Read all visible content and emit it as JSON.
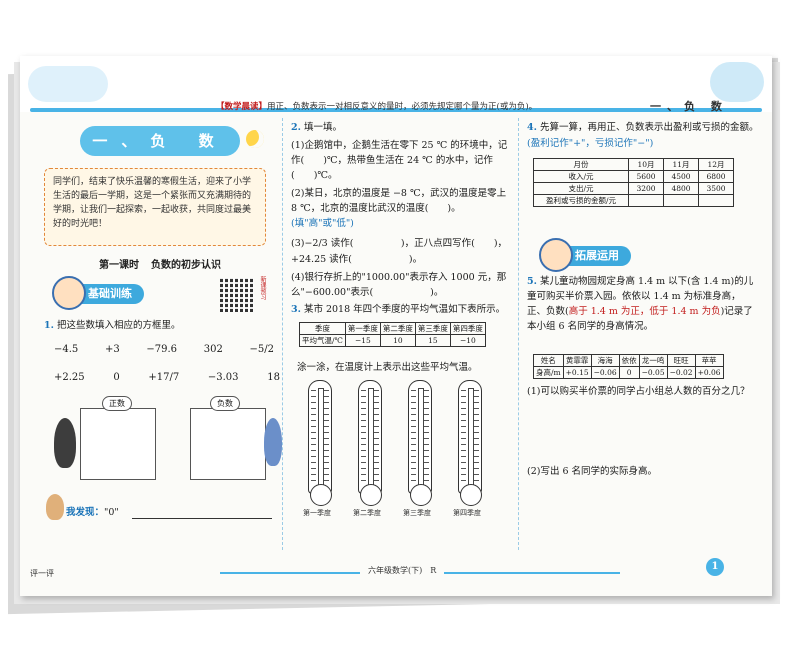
{
  "header": {
    "reading_label": "【数学晨读】",
    "reading_text": "用正、负数表示一对相反意义的量时，必须先规定哪个量为正(或为负)。",
    "unit_title": "一、负 数"
  },
  "col1": {
    "chapter_title": "一、负 数",
    "intro": "同学们，结束了快乐温馨的寒假生活，迎来了小学生活的最后一学期，这是一个紧张而又充满期待的学期，让我们一起探索，一起收获，共同度过最美好的时光吧！",
    "lesson_label": "第一课时",
    "lesson_title": "负数的初步认识",
    "section_tag": "基础训练",
    "qr_label": "新课预习",
    "q1_num": "1.",
    "q1_text": "把这些数填入相应的方框里。",
    "row1": [
      "−4.5",
      "+3",
      "−79.6",
      "302",
      "−5/2"
    ],
    "row2": [
      "+2.25",
      "0",
      "+17/7",
      "−3.03",
      "18"
    ],
    "bubble_positive": "正数",
    "bubble_negative": "负数",
    "find_label": "我发现：",
    "find_text": "\"0\""
  },
  "col2": {
    "q2_num": "2.",
    "q2_title": "填一填。",
    "q2_1": "(1)企鹅馆中，企鹅生活在零下 25 ℃ 的环境中，记作(　　)℃，热带鱼生活在 24 ℃ 的水中，记作(　　)℃。",
    "q2_2": "(2)某日，北京的温度是 −8 ℃，武汉的温度是零上 8 ℃，北京的温度比武汉的温度(　　)。",
    "q2_2_hint": "(填\"高\"或\"低\")",
    "q2_3a": "(3)−2/3 读作(　　　　　)，正八点四写作(　　)，",
    "q2_3b": "+24.25 读作(　　　　　　)。",
    "q2_4": "(4)银行存折上的\"1000.00\"表示存入 1000 元，那么\"−600.00\"表示(　　　　　　)。",
    "q3_num": "3.",
    "q3_text": "某市 2018 年四个季度的平均气温如下表所示。",
    "q3_note": "涂一涂，在温度计上表示出这些平均气温。"
  },
  "table1": {
    "header": [
      "季度",
      "第一季度",
      "第二季度",
      "第三季度",
      "第四季度"
    ],
    "row": [
      "平均气温/℃",
      "−15",
      "10",
      "15",
      "−10"
    ]
  },
  "thermometers": [
    "第一季度",
    "第二季度",
    "第三季度",
    "第四季度"
  ],
  "col3": {
    "q4_num": "4.",
    "q4_text": "先算一算，再用正、负数表示出盈利或亏损的金额。",
    "q4_hint": "(盈利记作\"+\"，亏损记作\"−\")",
    "section_tag": "拓展运用",
    "q5_num": "5.",
    "q5_text": "某儿童动物园规定身高 1.4 m 以下(含 1.4 m)的儿童可购买半价票入园。依依以 1.4 m 为标准身高，正、负数(",
    "q5_hl": "高于 1.4 m 为正，低于 1.4 m 为负",
    "q5_tail": ")记录了本小组 6 名同学的身高情况。",
    "q5_1": "(1)可以购买半价票的同学占小组总人数的百分之几？",
    "q5_2": "(2)写出 6 名同学的实际身高。"
  },
  "table2": {
    "header": [
      "月份",
      "10月",
      "11月",
      "12月"
    ],
    "rows": [
      [
        "收入/元",
        "5600",
        "4500",
        "6800"
      ],
      [
        "支出/元",
        "3200",
        "4800",
        "3500"
      ],
      [
        "盈利或亏损的金额/元",
        "",
        "",
        ""
      ]
    ]
  },
  "table3": {
    "header": [
      "姓名",
      "黄霏霏",
      "海海",
      "依依",
      "龙一鸣",
      "旺旺",
      "苹苹"
    ],
    "row": [
      "身高/m",
      "+0.15",
      "−0.06",
      "0",
      "−0.05",
      "−0.02",
      "+0.06"
    ]
  },
  "footer": {
    "left_label": "评一评",
    "book_title": "六年级数学(下)　R",
    "page_number": "1"
  }
}
